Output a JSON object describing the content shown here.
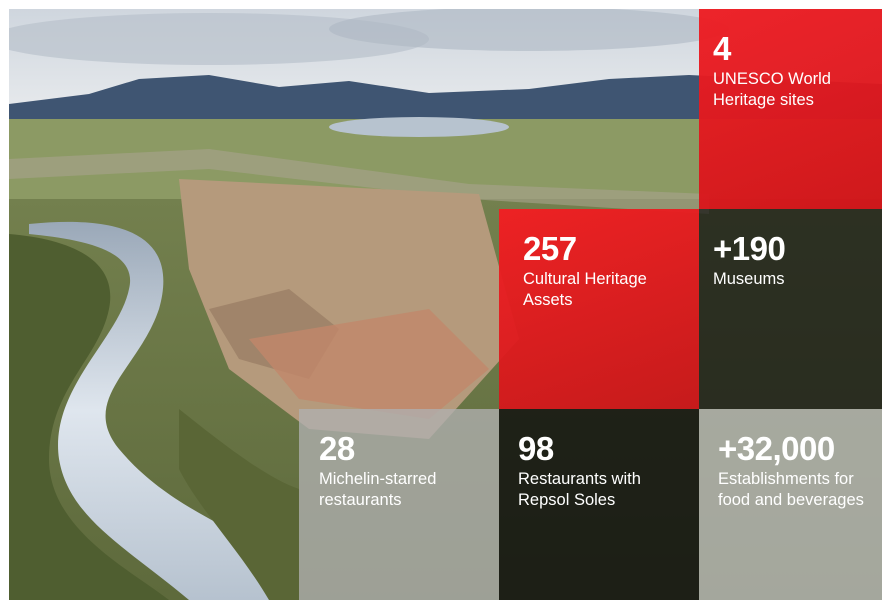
{
  "background_image": "aerial-town-river-photo",
  "colors": {
    "accent_red": "#EE1E24",
    "dark_tile": "#121212",
    "grey_tile": "#AFAFAF",
    "text": "#FFFFFF"
  },
  "tiles": [
    {
      "id": "unesco",
      "number": "4",
      "label_line1": "UNESCO World",
      "label_line2": "Heritage sites"
    },
    {
      "id": "cultural",
      "number": "257",
      "label_line1": "Cultural Heritage",
      "label_line2": "Assets"
    },
    {
      "id": "museums",
      "number": "+190",
      "label_line1": "Museums",
      "label_line2": ""
    },
    {
      "id": "michelin",
      "number": "28",
      "label_line1": "Michelin-starred",
      "label_line2": "restaurants"
    },
    {
      "id": "repsol",
      "number": "98",
      "label_line1": "Restaurants with",
      "label_line2": "Repsol Soles"
    },
    {
      "id": "establishments",
      "number": "+32,000",
      "label_line1": "Establishments for",
      "label_line2": "food and beverages"
    }
  ]
}
